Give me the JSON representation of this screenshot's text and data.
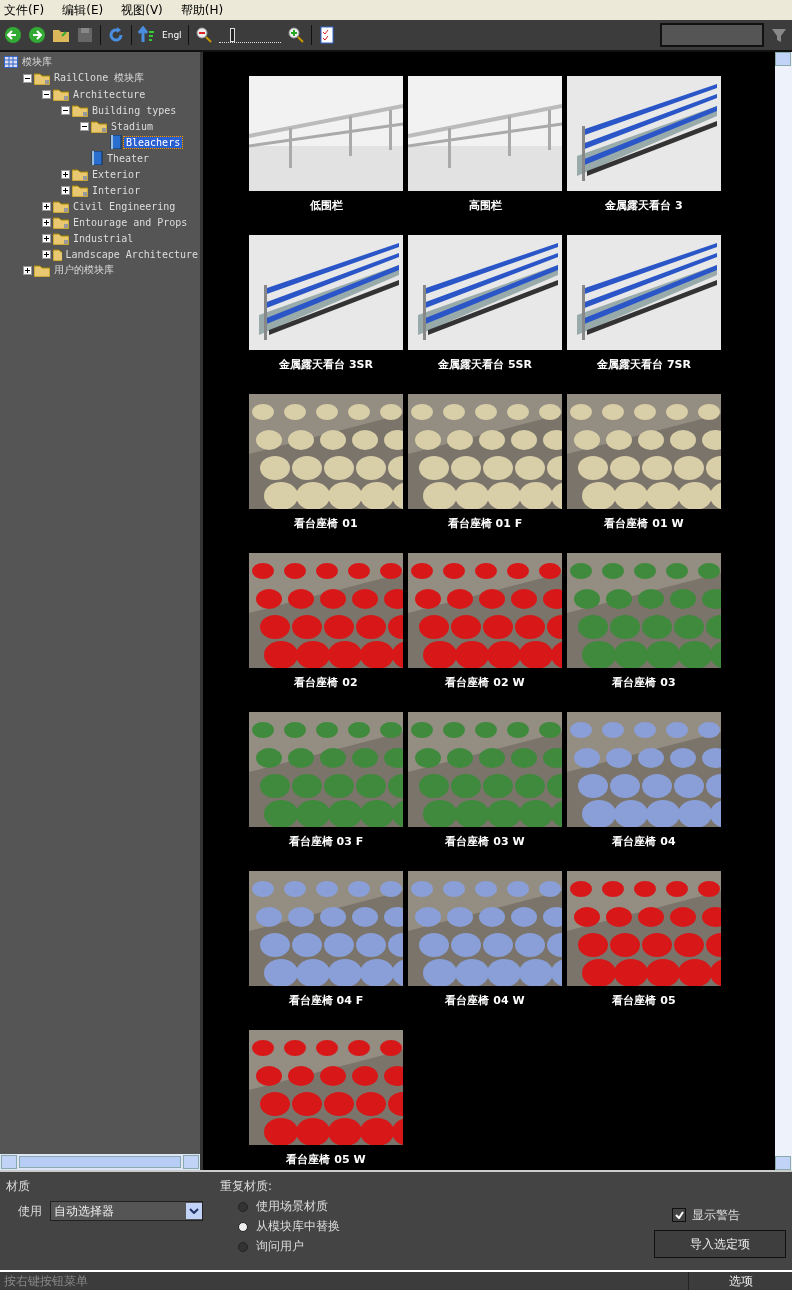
{
  "menu": [
    "文件(F)",
    "编辑(E)",
    "视图(V)",
    "帮助(H)"
  ],
  "toolbar": {
    "language": "Engl",
    "zoom": {
      "level": 0.2
    }
  },
  "tree": [
    {
      "label": "模块库",
      "kind": "root",
      "selected": false,
      "children": [
        {
          "label": "RailClone 模块库",
          "kind": "folder",
          "expanded": true,
          "selected": false,
          "children": [
            {
              "label": "Architecture",
              "kind": "folder",
              "expanded": true,
              "selected": false,
              "children": [
                {
                  "label": "Building types",
                  "kind": "folder",
                  "expanded": true,
                  "selected": false,
                  "children": [
                    {
                      "label": "Stadium",
                      "kind": "folder",
                      "expanded": true,
                      "selected": false,
                      "children": [
                        {
                          "label": "Bleachers",
                          "kind": "book",
                          "selected": true
                        }
                      ]
                    },
                    {
                      "label": "Theater",
                      "kind": "book",
                      "selected": false
                    }
                  ]
                },
                {
                  "label": "Exterior",
                  "kind": "folder",
                  "expanded": false,
                  "selected": false
                },
                {
                  "label": "Interior",
                  "kind": "folder",
                  "expanded": false,
                  "selected": false
                }
              ]
            },
            {
              "label": "Civil Engineering",
              "kind": "folder",
              "expanded": false,
              "selected": false
            },
            {
              "label": "Entourage and Props",
              "kind": "folder",
              "expanded": false,
              "selected": false
            },
            {
              "label": "Industrial",
              "kind": "folder",
              "expanded": false,
              "selected": false
            },
            {
              "label": "Landscape Architecture",
              "kind": "folder",
              "expanded": false,
              "selected": false
            }
          ]
        },
        {
          "label": "用户的模块库",
          "kind": "plainfolder",
          "expanded": false,
          "selected": false
        }
      ]
    }
  ],
  "thumbnails": [
    {
      "label": "低围栏",
      "kind": "railing"
    },
    {
      "label": "高围栏",
      "kind": "railing"
    },
    {
      "label": "金属露天看台 3",
      "kind": "bleacher"
    },
    {
      "label": "金属露天看台 3SR",
      "kind": "bleacher"
    },
    {
      "label": "金属露天看台 5SR",
      "kind": "bleacher"
    },
    {
      "label": "金属露天看台 7SR",
      "kind": "bleacher"
    },
    {
      "label": "看台座椅 01",
      "kind": "beige"
    },
    {
      "label": "看台座椅 01 F",
      "kind": "beige"
    },
    {
      "label": "看台座椅 01 W",
      "kind": "beige"
    },
    {
      "label": "看台座椅 02",
      "kind": "red"
    },
    {
      "label": "看台座椅 02 W",
      "kind": "red"
    },
    {
      "label": "看台座椅 03",
      "kind": "green"
    },
    {
      "label": "看台座椅 03 F",
      "kind": "green"
    },
    {
      "label": "看台座椅 03 W",
      "kind": "green"
    },
    {
      "label": "看台座椅 04",
      "kind": "blue"
    },
    {
      "label": "看台座椅 04 F",
      "kind": "blue"
    },
    {
      "label": "看台座椅 04 W",
      "kind": "blue"
    },
    {
      "label": "看台座椅 05",
      "kind": "red"
    },
    {
      "label": "看台座椅 05 W",
      "kind": "red"
    }
  ],
  "material": {
    "title": "材质",
    "use_label": "使用",
    "use_value": "自动选择器"
  },
  "repeat": {
    "title": "重复材质:",
    "options": [
      {
        "label": "使用场景材质",
        "selected": false
      },
      {
        "label": "从模块库中替换",
        "selected": true
      },
      {
        "label": "询问用户",
        "selected": false
      }
    ]
  },
  "show_warnings": {
    "label": "显示警告",
    "checked": true
  },
  "import_button": "导入选定项",
  "status_bar": {
    "text": "按右键按钮菜单",
    "options_button": "选项"
  }
}
